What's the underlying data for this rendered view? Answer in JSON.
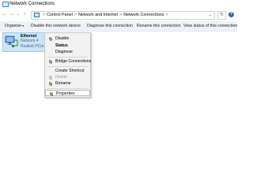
{
  "window": {
    "title": "Network Connections"
  },
  "nav": {
    "back": "←",
    "forward": "→",
    "dropdown": "⌄",
    "up": "↑",
    "refresh": "↻",
    "help": "?"
  },
  "address": {
    "parts": [
      "Control Panel",
      "Network and Internet",
      "Network Connections"
    ],
    "separator": ">",
    "expand": "⌄"
  },
  "toolbar": {
    "organize": "Organize",
    "organize_caret": "▾",
    "disable": "Disable this network device",
    "diagnose": "Diagnose this connection",
    "rename": "Rename this connection",
    "view_status": "View status of this connection"
  },
  "adapter": {
    "name": "Ethernet",
    "status": "Network 4",
    "device": "Realtek PCIe G"
  },
  "context_menu": {
    "items": [
      {
        "label": "Disable"
      },
      {
        "label": "Status"
      },
      {
        "label": "Diagnose"
      },
      {
        "label": "Bridge Connections"
      },
      {
        "label": "Create Shortcut"
      },
      {
        "label": "Delete"
      },
      {
        "label": "Rename"
      },
      {
        "label": "Properties"
      }
    ]
  },
  "colors": {
    "selection": "#cce4f7",
    "command_bar": "#eef2f8",
    "shield_blue": "#2f6fb0",
    "shield_yellow": "#f2c12e"
  }
}
